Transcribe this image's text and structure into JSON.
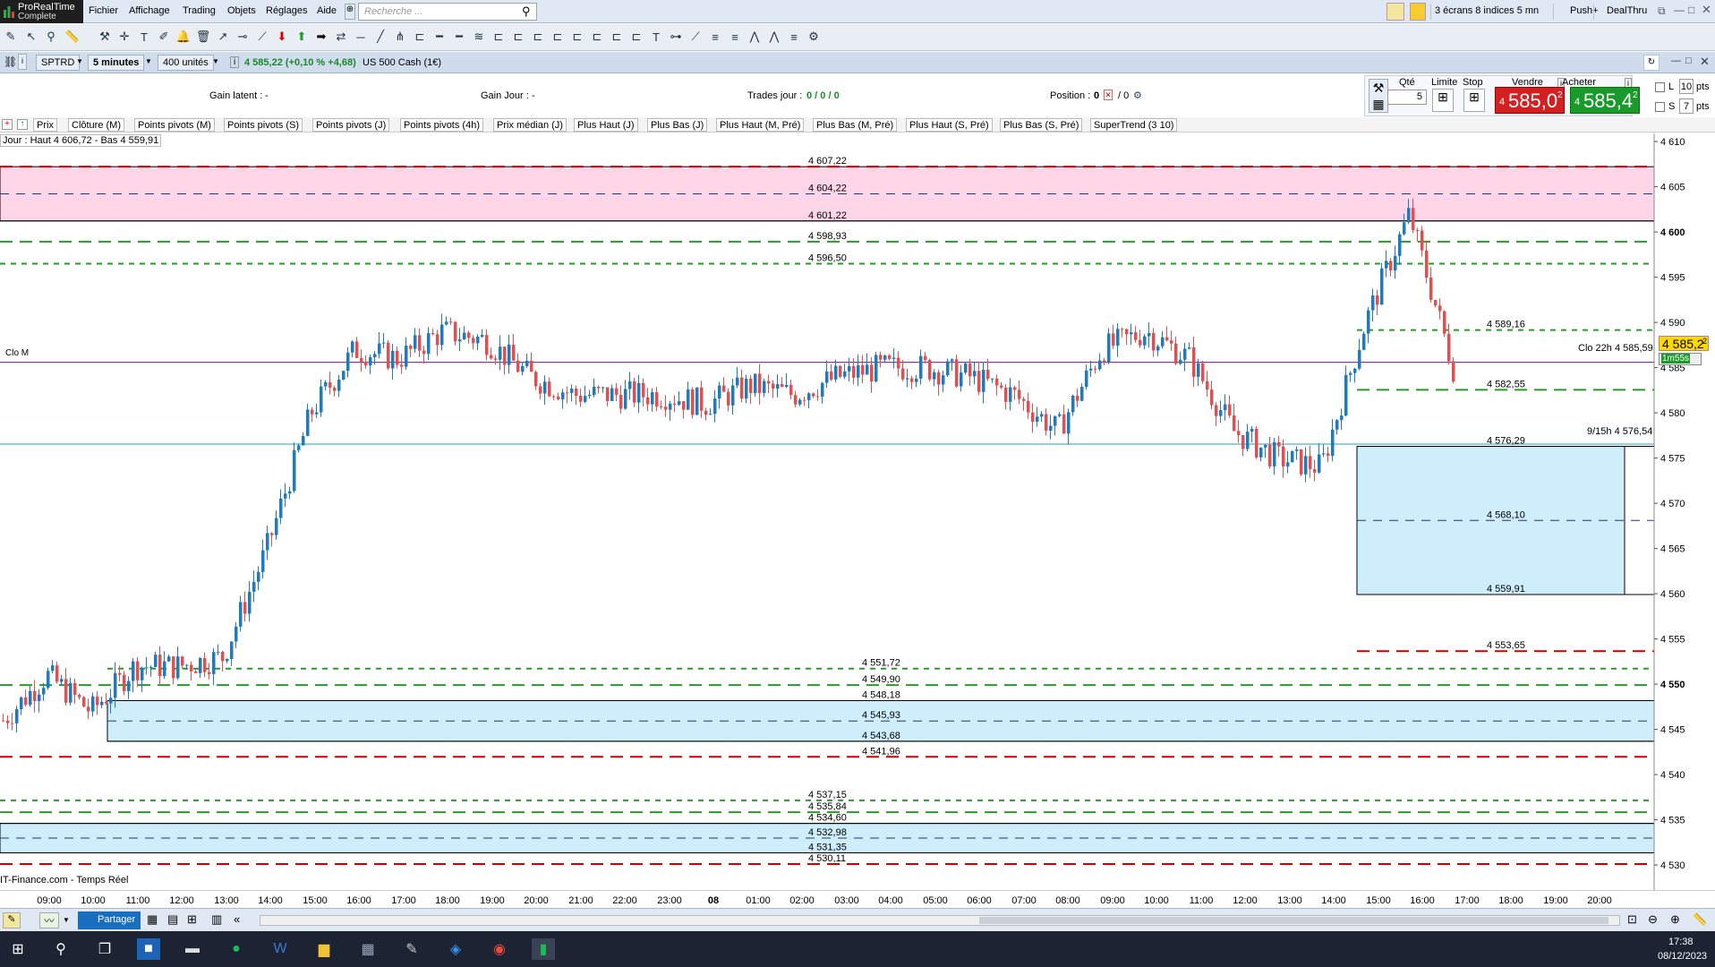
{
  "app": {
    "brand_line1": "ProRealTime",
    "brand_line2": "Complete"
  },
  "menu": [
    "Fichier",
    "Affichage",
    "Trading",
    "Objets",
    "Réglages",
    "Aide"
  ],
  "search": {
    "placeholder": "Recherche ..."
  },
  "top_right": {
    "layout": "3 écrans 8 indices 5 mn",
    "push": "Push+",
    "dealthru": "DealThru"
  },
  "window_bar": {
    "symbol": "SPTRD",
    "timeframe": "5 minutes",
    "units": "400 unités",
    "quote": "4 585,22 (+0,10 % +4,68)",
    "instrument": "US 500 Cash (1€)"
  },
  "info": {
    "gain_latent_label": "Gain latent :",
    "gain_latent_value": "-",
    "gain_jour_label": "Gain Jour :",
    "gain_jour_value": "-",
    "trades_label": "Trades jour :",
    "trades_value": "0 / 0 / 0",
    "position_label": "Position :",
    "position_value": "0",
    "position_extra": "/ 0"
  },
  "order_panel": {
    "qty_label": "Qté",
    "qty_value": "5",
    "limit_label": "Limite",
    "stop_label": "Stop",
    "sell_label": "Vendre",
    "buy_label": "Acheter",
    "sell_price_prefix": "4",
    "sell_price": "585,0",
    "sell_sup": "2",
    "buy_price_prefix": "4",
    "buy_price": "585,4",
    "buy_sup": "2",
    "l_label": "L",
    "l_value": "10",
    "s_label": "S",
    "s_value": "7",
    "pts": "pts",
    "sell_color": "#d42020",
    "buy_color": "#1a9a2a"
  },
  "indicators": [
    "Prix",
    "Clôture (M)",
    "Points pivots (M)",
    "Points pivots (S)",
    "Points pivots (J)",
    "Points pivots (4h)",
    "Prix médian (J)",
    "Plus Haut (J)",
    "Plus Bas (J)",
    "Plus Haut (M, Pré)",
    "Plus Bas (M, Pré)",
    "Plus Haut (S, Pré)",
    "Plus Bas (S, Pré)",
    "SuperTrend (3 10)"
  ],
  "chart": {
    "top_label": "Jour : Haut 4 606,72 - Bas 4 559,91",
    "clo_m_label": "Clo M",
    "price_axis": [
      "4 610",
      "4 605",
      "4 600",
      "4 595",
      "4 590",
      "4 585",
      "4 580",
      "4 575",
      "4 570",
      "4 565",
      "4 560",
      "4 555",
      "4 550",
      "4 545",
      "4 540",
      "4 535",
      "4 530"
    ],
    "level_labels": [
      "4 607,22",
      "4 604,22",
      "4 601,22",
      "4 598,93",
      "4 596,50",
      "4 589,16",
      "4 582,55",
      "4 576,29",
      "4 568,10",
      "4 559,91",
      "4 553,65",
      "4 551,72",
      "4 549,90",
      "4 548,18",
      "4 545,93",
      "4 543,68",
      "4 541,96",
      "4 537,15",
      "4 535,84",
      "4 534,60",
      "4 532,98",
      "4 531,35",
      "4 530,11"
    ],
    "clo22_label": "Clo 22h 4 585,59",
    "d915_label": "9/15h 4 576,54",
    "current_price": "4 585,2",
    "current_sup": "2",
    "countdown": "1m55s",
    "countdown_price": "4 585,22",
    "source": "IT-Finance.com - Temps Réel",
    "time_axis": [
      "09:00",
      "10:00",
      "11:00",
      "12:00",
      "13:00",
      "14:00",
      "15:00",
      "16:00",
      "17:00",
      "18:00",
      "19:00",
      "20:00",
      "21:00",
      "22:00",
      "23:00",
      "08",
      "01:00",
      "02:00",
      "03:00",
      "04:00",
      "05:00",
      "06:00",
      "07:00",
      "08:00",
      "09:00",
      "10:00",
      "11:00",
      "12:00",
      "13:00",
      "14:00",
      "15:00",
      "16:00",
      "17:00",
      "18:00",
      "19:00",
      "20:00"
    ]
  },
  "bottom": {
    "share": "Partager"
  },
  "clock": {
    "time": "17:38",
    "date": "08/12/2023"
  },
  "chart_data": {
    "type": "candlestick",
    "instrument": "US 500 Cash (1€)",
    "timeframe": "5 minutes",
    "ylim": [
      4526,
      4612
    ],
    "x": [
      "09:00",
      "10:00",
      "11:00",
      "12:00",
      "13:00",
      "14:00",
      "15:00",
      "16:00",
      "17:00",
      "18:00",
      "19:00",
      "20:00",
      "21:00",
      "22:00",
      "23:00",
      "08",
      "01:00",
      "02:00",
      "03:00",
      "04:00",
      "05:00",
      "06:00",
      "07:00",
      "08:00",
      "09:00",
      "10:00",
      "11:00",
      "12:00",
      "13:00",
      "14:00",
      "15:00",
      "16:00",
      "17:00",
      "17:30"
    ],
    "close_path": [
      4546,
      4551,
      4547,
      4552,
      4552,
      4553,
      4565,
      4580,
      4587,
      4586,
      4589,
      4588,
      4584,
      4582,
      4582,
      4582,
      4581,
      4583,
      4582,
      4584,
      4585,
      4585,
      4584,
      4582,
      4578,
      4587,
      4589,
      4586,
      4578,
      4575,
      4574,
      4590,
      4602,
      4585
    ],
    "series": [
      {
        "name": "Prix",
        "values": [
          4546,
          4551,
          4547,
          4552,
          4552,
          4553,
          4565,
          4580,
          4587,
          4586,
          4589,
          4588,
          4584,
          4582,
          4582,
          4582,
          4581,
          4583,
          4582,
          4584,
          4585,
          4585,
          4584,
          4582,
          4578,
          4587,
          4589,
          4586,
          4578,
          4575,
          4574,
          4590,
          4602,
          4585
        ]
      }
    ],
    "levels": [
      4607.22,
      4604.22,
      4601.22,
      4598.93,
      4596.5,
      4589.16,
      4585.59,
      4582.55,
      4576.54,
      4576.29,
      4568.1,
      4559.91,
      4553.65,
      4551.72,
      4549.9,
      4548.18,
      4545.93,
      4543.68,
      4541.96,
      4537.15,
      4535.84,
      4534.6,
      4532.98,
      4531.35,
      4530.11
    ],
    "zones": [
      {
        "from": 4601.22,
        "to": 4607.22,
        "color": "#ffd6e8"
      },
      {
        "from": 4548.18,
        "to": 4543.68,
        "color": "#cfeefb"
      },
      {
        "from": 4534.6,
        "to": 4531.35,
        "color": "#cfeefb"
      },
      {
        "from": 4576.29,
        "to": 4559.91,
        "color": "#cfeefb"
      }
    ],
    "colors": {
      "up": "#1f7bc0",
      "down": "#e05050",
      "red_dash": "#cc0000",
      "green_dash": "#2a9a2a",
      "blue_dash": "#223388",
      "cyan_line": "#19a0c8",
      "purple_line": "#6a1a8a"
    }
  }
}
